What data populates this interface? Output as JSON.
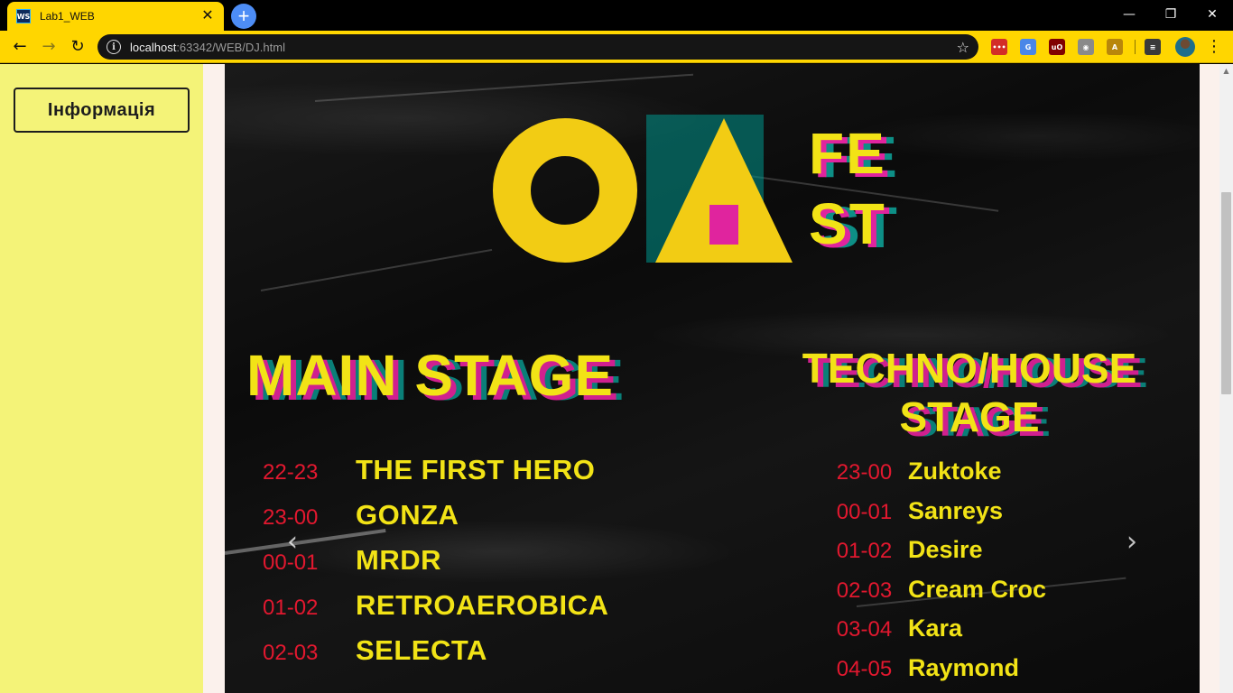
{
  "browser": {
    "tab_title": "Lab1_WEB",
    "tab_favicon": "WS",
    "tab_close": "✕",
    "new_tab": "+",
    "window_minimize": "—",
    "window_restore": "❐",
    "window_close": "✕",
    "url_host": "localhost",
    "url_rest": ":63342/WEB/DJ.html",
    "back": "←",
    "forward": "→",
    "reload": "↻",
    "info": "i",
    "bookmark": "☆",
    "menu": "⋮",
    "extensions": [
      {
        "name": "lastpass-icon",
        "label": "•••",
        "color": "#d32d27"
      },
      {
        "name": "translate-icon",
        "label": "G",
        "color": "#4a86e8"
      },
      {
        "name": "ublock-icon",
        "label": "uO",
        "color": "#800000"
      },
      {
        "name": "camera-icon",
        "label": "◉",
        "color": "#8a8a8a"
      },
      {
        "name": "pdf-icon",
        "label": "A",
        "color": "#b8860b"
      },
      {
        "name": "playlist-icon",
        "label": "≡",
        "color": "#3a3a3a"
      }
    ]
  },
  "sidebar": {
    "info_button": "Інформація"
  },
  "poster": {
    "logo_fest_line1": "FE",
    "logo_fest_line2": "ST",
    "main_stage_title": "MAIN STAGE",
    "techno_stage_title_line1": "TECHNO/HOUSE",
    "techno_stage_title_line2": "STAGE",
    "main_stage": [
      {
        "time": "22-23",
        "act": "THE FIRST HERO"
      },
      {
        "time": "23-00",
        "act": "GONZA"
      },
      {
        "time": "00-01",
        "act": "MRDR"
      },
      {
        "time": "01-02",
        "act": "RETROAEROBICA"
      },
      {
        "time": "02-03",
        "act": "SELECTA"
      }
    ],
    "techno_stage": [
      {
        "time": "23-00",
        "act": "Zuktoke"
      },
      {
        "time": "00-01",
        "act": "Sanreys"
      },
      {
        "time": "01-02",
        "act": "Desire"
      },
      {
        "time": "02-03",
        "act": "Cream Croc"
      },
      {
        "time": "03-04",
        "act": "Kara"
      },
      {
        "time": "04-05",
        "act": "Raymond"
      }
    ]
  },
  "carousel": {
    "prev": "‹",
    "next": "›"
  },
  "colors": {
    "browser_accent": "#ffd600",
    "sidebar_bg": "#f4f378",
    "poster_yellow": "#f2e316",
    "poster_red": "#e2182f",
    "poster_magenta": "#d0208f",
    "poster_teal": "#0a7f78"
  }
}
